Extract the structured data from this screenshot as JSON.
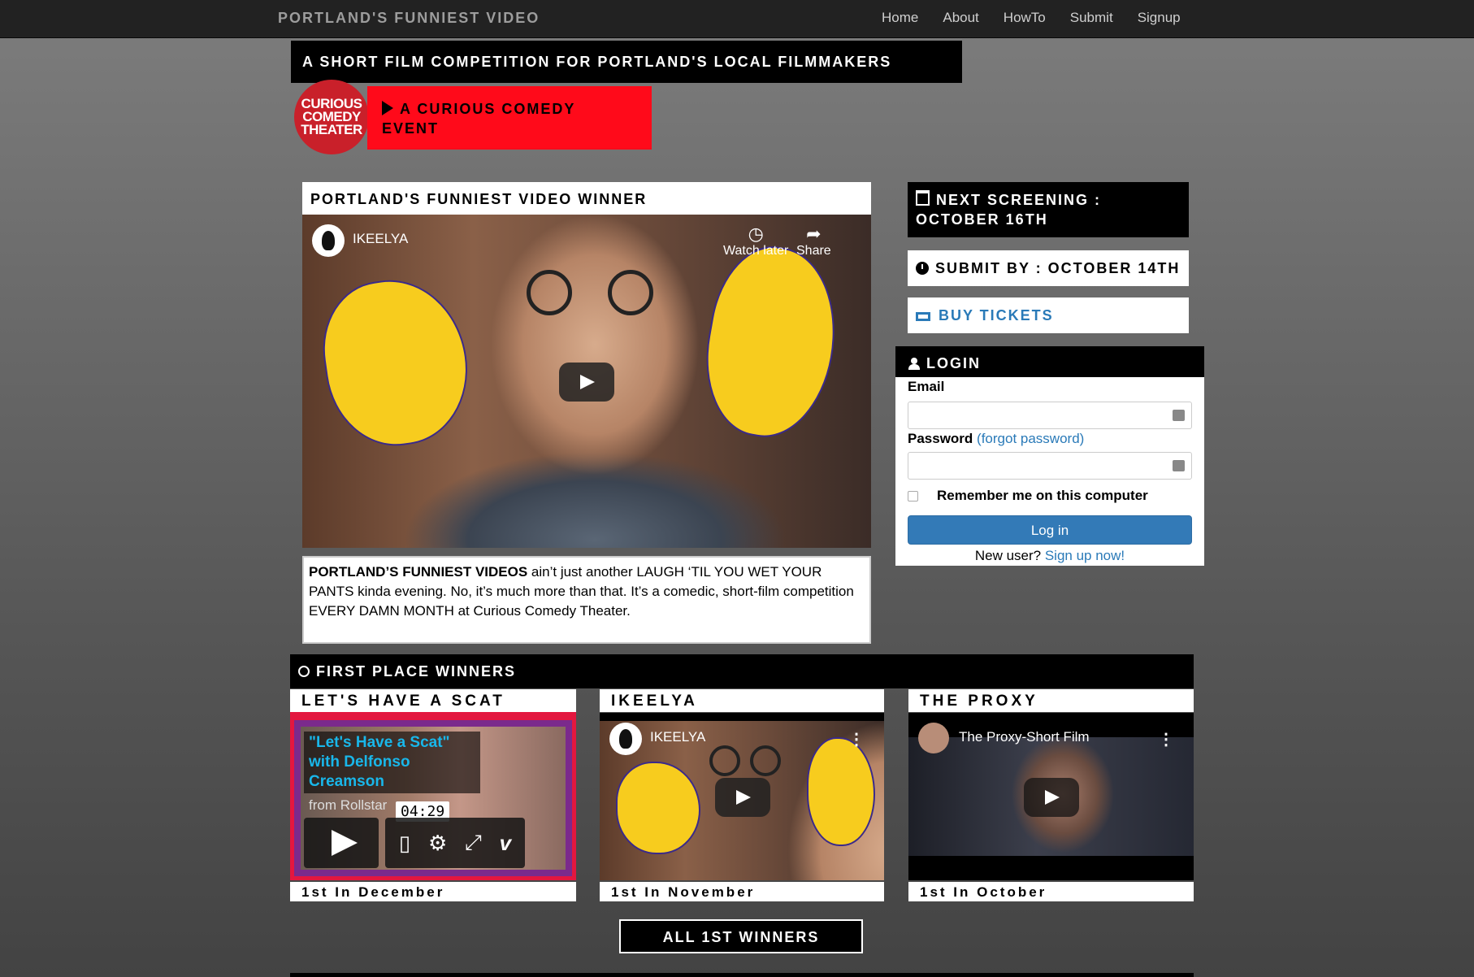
{
  "nav": {
    "brand": "PORTLAND'S FUNNIEST VIDEO",
    "links": [
      "Home",
      "About",
      "HowTo",
      "Submit",
      "Signup"
    ]
  },
  "header": {
    "tagline": "A SHORT FILM COMPETITION FOR PORTLAND'S LOCAL FILMMAKERS",
    "logo_lines": [
      "CURIOUS",
      "COMEDY",
      "THEATER"
    ],
    "event_badge": "A CURIOUS COMEDY EVENT"
  },
  "winner": {
    "heading": "PORTLAND'S FUNNIEST VIDEO WINNER",
    "video": {
      "channel": "IKEELYA",
      "watch_later": "Watch later",
      "share": "Share"
    },
    "description_bold": "PORTLAND’S FUNNIEST VIDEOS",
    "description_rest": " ain’t just another LAUGH ‘TIL YOU WET YOUR PANTS kinda evening. No, it’s much more than that. It’s a comedic, short-film competition EVERY DAMN MONTH at Curious Comedy Theater."
  },
  "sidebar": {
    "next_screening": "NEXT SCREENING : OCTOBER 16TH",
    "submit_by": "SUBMIT BY : OCTOBER 14TH",
    "buy_tickets": "BUY TICKETS"
  },
  "login": {
    "heading": "LOGIN",
    "email_label": "Email",
    "email_value": "",
    "password_label": "Password",
    "forgot_link": "(forgot password)",
    "password_value": "",
    "remember_label": "Remember me on this computer",
    "remember_checked": false,
    "submit_label": "Log in",
    "new_user_text": "New user?",
    "signup_link": "Sign up now!"
  },
  "winners": {
    "heading": "FIRST PLACE WINNERS",
    "cards": [
      {
        "title": "LET'S HAVE A SCAT",
        "footer": "1st In December",
        "video_title": "\"Let's Have a Scat\" with Delfonso Creamson",
        "video_from": "from Rollstar",
        "duration": "04:29"
      },
      {
        "title": "IKEELYA",
        "footer": "1st In November",
        "channel": "IKEELYA"
      },
      {
        "title": "THE PROXY",
        "footer": "1st In October",
        "channel": "The Proxy-Short Film"
      }
    ],
    "all_button": "ALL 1ST WINNERS"
  },
  "colors": {
    "accent_red": "#ff0a1a",
    "link_blue": "#2a7ab8",
    "button_blue": "#337ab7",
    "logo_red": "#c9202a",
    "vimeo_blue": "#19b7ea"
  }
}
